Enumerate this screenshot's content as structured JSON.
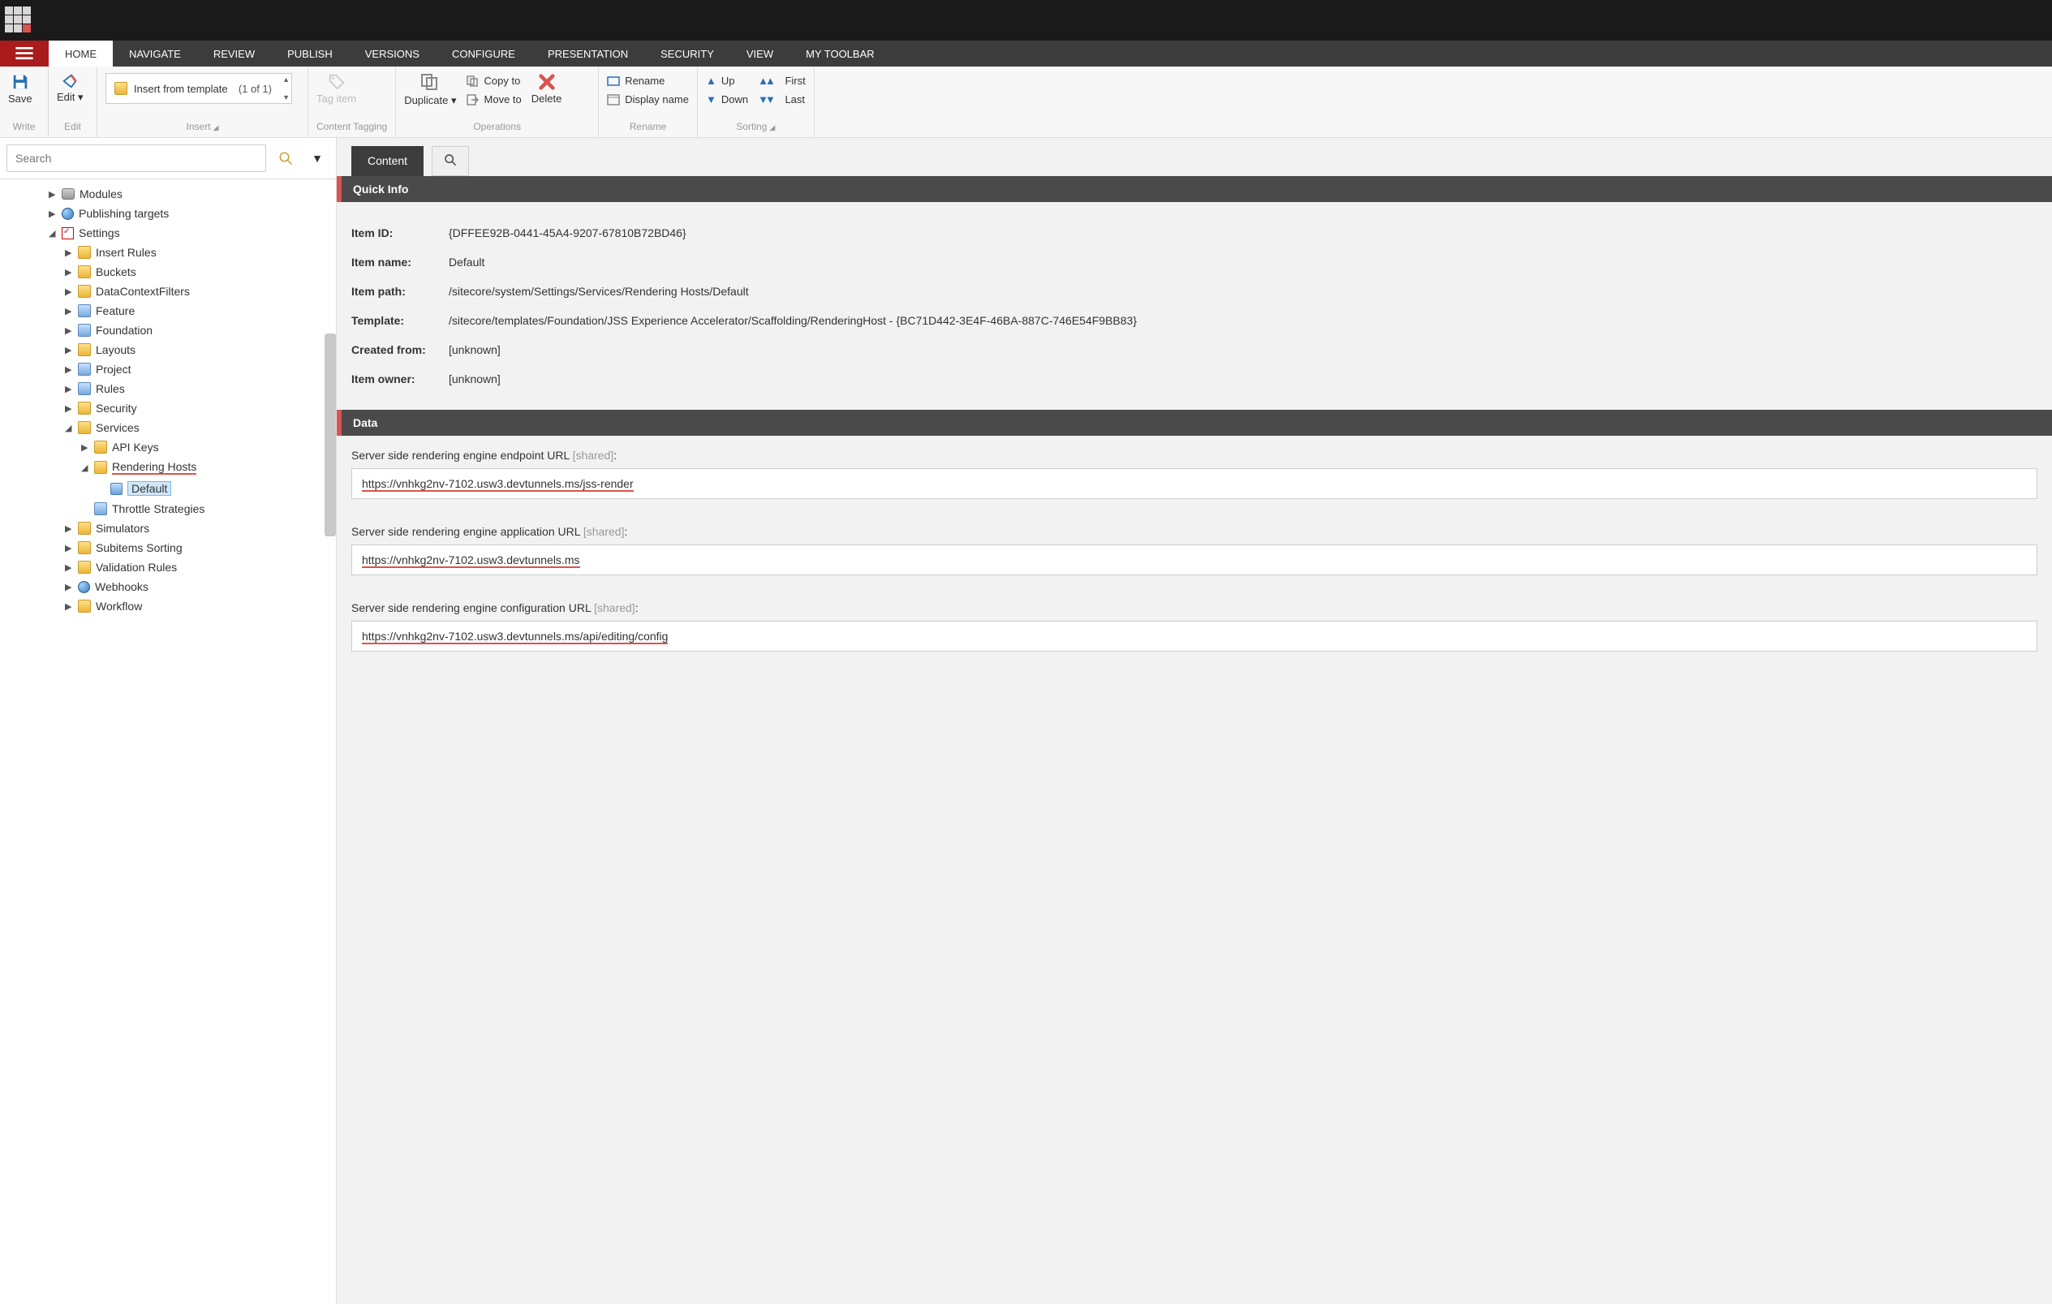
{
  "menu": {
    "tabs": [
      "HOME",
      "NAVIGATE",
      "REVIEW",
      "PUBLISH",
      "VERSIONS",
      "CONFIGURE",
      "PRESENTATION",
      "SECURITY",
      "VIEW",
      "MY TOOLBAR"
    ]
  },
  "ribbon": {
    "save": "Save",
    "write": "Write",
    "edit": "Edit",
    "edit_group": "Edit",
    "insert_from_template": "Insert from template",
    "insert_count": "(1 of 1)",
    "insert": "Insert",
    "tag_item": "Tag item",
    "content_tagging": "Content Tagging",
    "duplicate": "Duplicate",
    "copy_to": "Copy to",
    "move_to": "Move to",
    "delete": "Delete",
    "operations": "Operations",
    "rename": "Rename",
    "display_name": "Display name",
    "rename_group": "Rename",
    "up": "Up",
    "down": "Down",
    "first": "First",
    "last": "Last",
    "sorting": "Sorting"
  },
  "search": {
    "placeholder": "Search"
  },
  "tree": {
    "modules": "Modules",
    "publishing_targets": "Publishing targets",
    "settings": "Settings",
    "insert_rules": "Insert Rules",
    "buckets": "Buckets",
    "datacontext": "DataContextFilters",
    "feature": "Feature",
    "foundation": "Foundation",
    "layouts": "Layouts",
    "project": "Project",
    "rules": "Rules",
    "security": "Security",
    "services": "Services",
    "api_keys": "API Keys",
    "rendering_hosts": "Rendering Hosts",
    "default": "Default",
    "throttle": "Throttle Strategies",
    "simulators": "Simulators",
    "subitems_sorting": "Subitems Sorting",
    "validation_rules": "Validation Rules",
    "webhooks": "Webhooks",
    "workflow": "Workflow"
  },
  "content_tab": "Content",
  "quick_info": {
    "title": "Quick Info",
    "item_id_k": "Item ID:",
    "item_id_v": "{DFFEE92B-0441-45A4-9207-67810B72BD46}",
    "item_name_k": "Item name:",
    "item_name_v": "Default",
    "item_path_k": "Item path:",
    "item_path_v": "/sitecore/system/Settings/Services/Rendering Hosts/Default",
    "template_k": "Template:",
    "template_v": "/sitecore/templates/Foundation/JSS Experience Accelerator/Scaffolding/RenderingHost - {BC71D442-3E4F-46BA-887C-746E54F9BB83}",
    "created_k": "Created from:",
    "created_v": "[unknown]",
    "owner_k": "Item owner:",
    "owner_v": "[unknown]"
  },
  "data_section": {
    "title": "Data",
    "shared": "[shared]",
    "f1_label": "Server side rendering engine endpoint URL",
    "f1_value": "https://vnhkg2nv-7102.usw3.devtunnels.ms/jss-render",
    "f2_label": "Server side rendering engine application URL",
    "f2_value": "https://vnhkg2nv-7102.usw3.devtunnels.ms",
    "f3_label": "Server side rendering engine configuration URL",
    "f3_value": "https://vnhkg2nv-7102.usw3.devtunnels.ms/api/editing/config"
  }
}
